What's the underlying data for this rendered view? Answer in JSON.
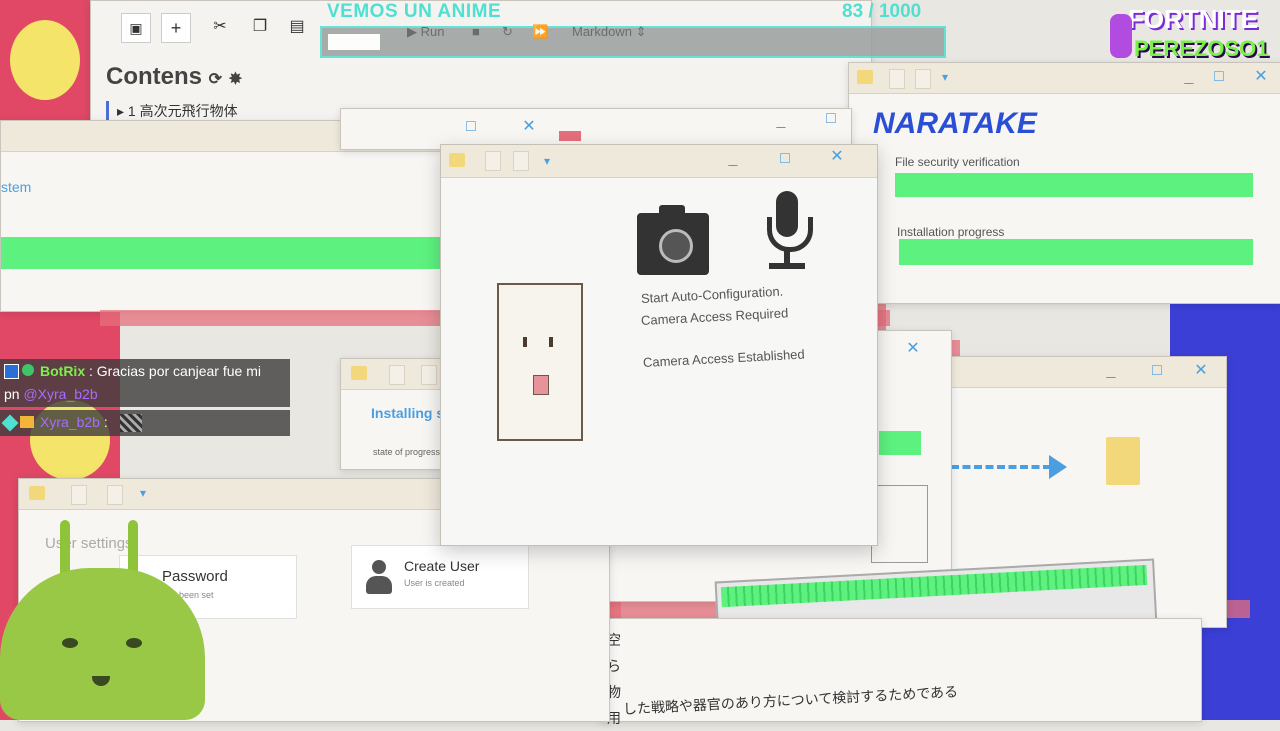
{
  "stream_header": {
    "title": "VEMOS UN ANIME",
    "progress_current": "83",
    "progress_total": "/ 1000",
    "progress_fraction": 0.083
  },
  "brand": {
    "line1": "FORTNITE",
    "line2": "PEREZOSO1"
  },
  "editor": {
    "run_label": "Run",
    "mode_label": "Markdown",
    "contents_title": "Contens",
    "toc_item": "1 高次元飛行物体"
  },
  "left_window": {
    "title_fragment": "stem"
  },
  "main_dialog": {
    "auto_config_label": "Start Auto-Configuration.",
    "camera_required_label": "Camera Access Required",
    "camera_established_label": "Camera Access Established"
  },
  "naratake_window": {
    "brand": "NARATAKE",
    "file_security_label": "File security verification",
    "install_progress_label": "Installation progress",
    "file_security_progress": 1.0,
    "install_progress": 1.0
  },
  "install_window": {
    "title": "Installing sy",
    "progress_label": "state of progress"
  },
  "settings_window": {
    "title": "User settings",
    "password_label": "Password",
    "password_sub": "has been set",
    "create_user_label": "Create User",
    "create_user_sub": "User is created"
  },
  "bottom_text": {
    "vertical_chars": [
      "空",
      "ら",
      "物",
      "用"
    ],
    "sentence": "した戦略や器官のあり方について検討するためである"
  },
  "chat": {
    "msg1_user": "BotRix",
    "msg1_text": ": Gracias por canjear fue mi",
    "msg1_cont": "pn",
    "msg1_mention": "@Xyra_b2b",
    "msg2_user": "Xyra_b2b",
    "msg2_sep": ":"
  },
  "colors": {
    "accent_blue": "#4b9fe0",
    "progress_green": "#5df27f",
    "alert_red": "#e56f7c",
    "header_teal": "#4fe0d2",
    "naratake_blue": "#2a4fd6",
    "chat_green": "#7cf04a",
    "chat_purple": "#a86bff"
  }
}
